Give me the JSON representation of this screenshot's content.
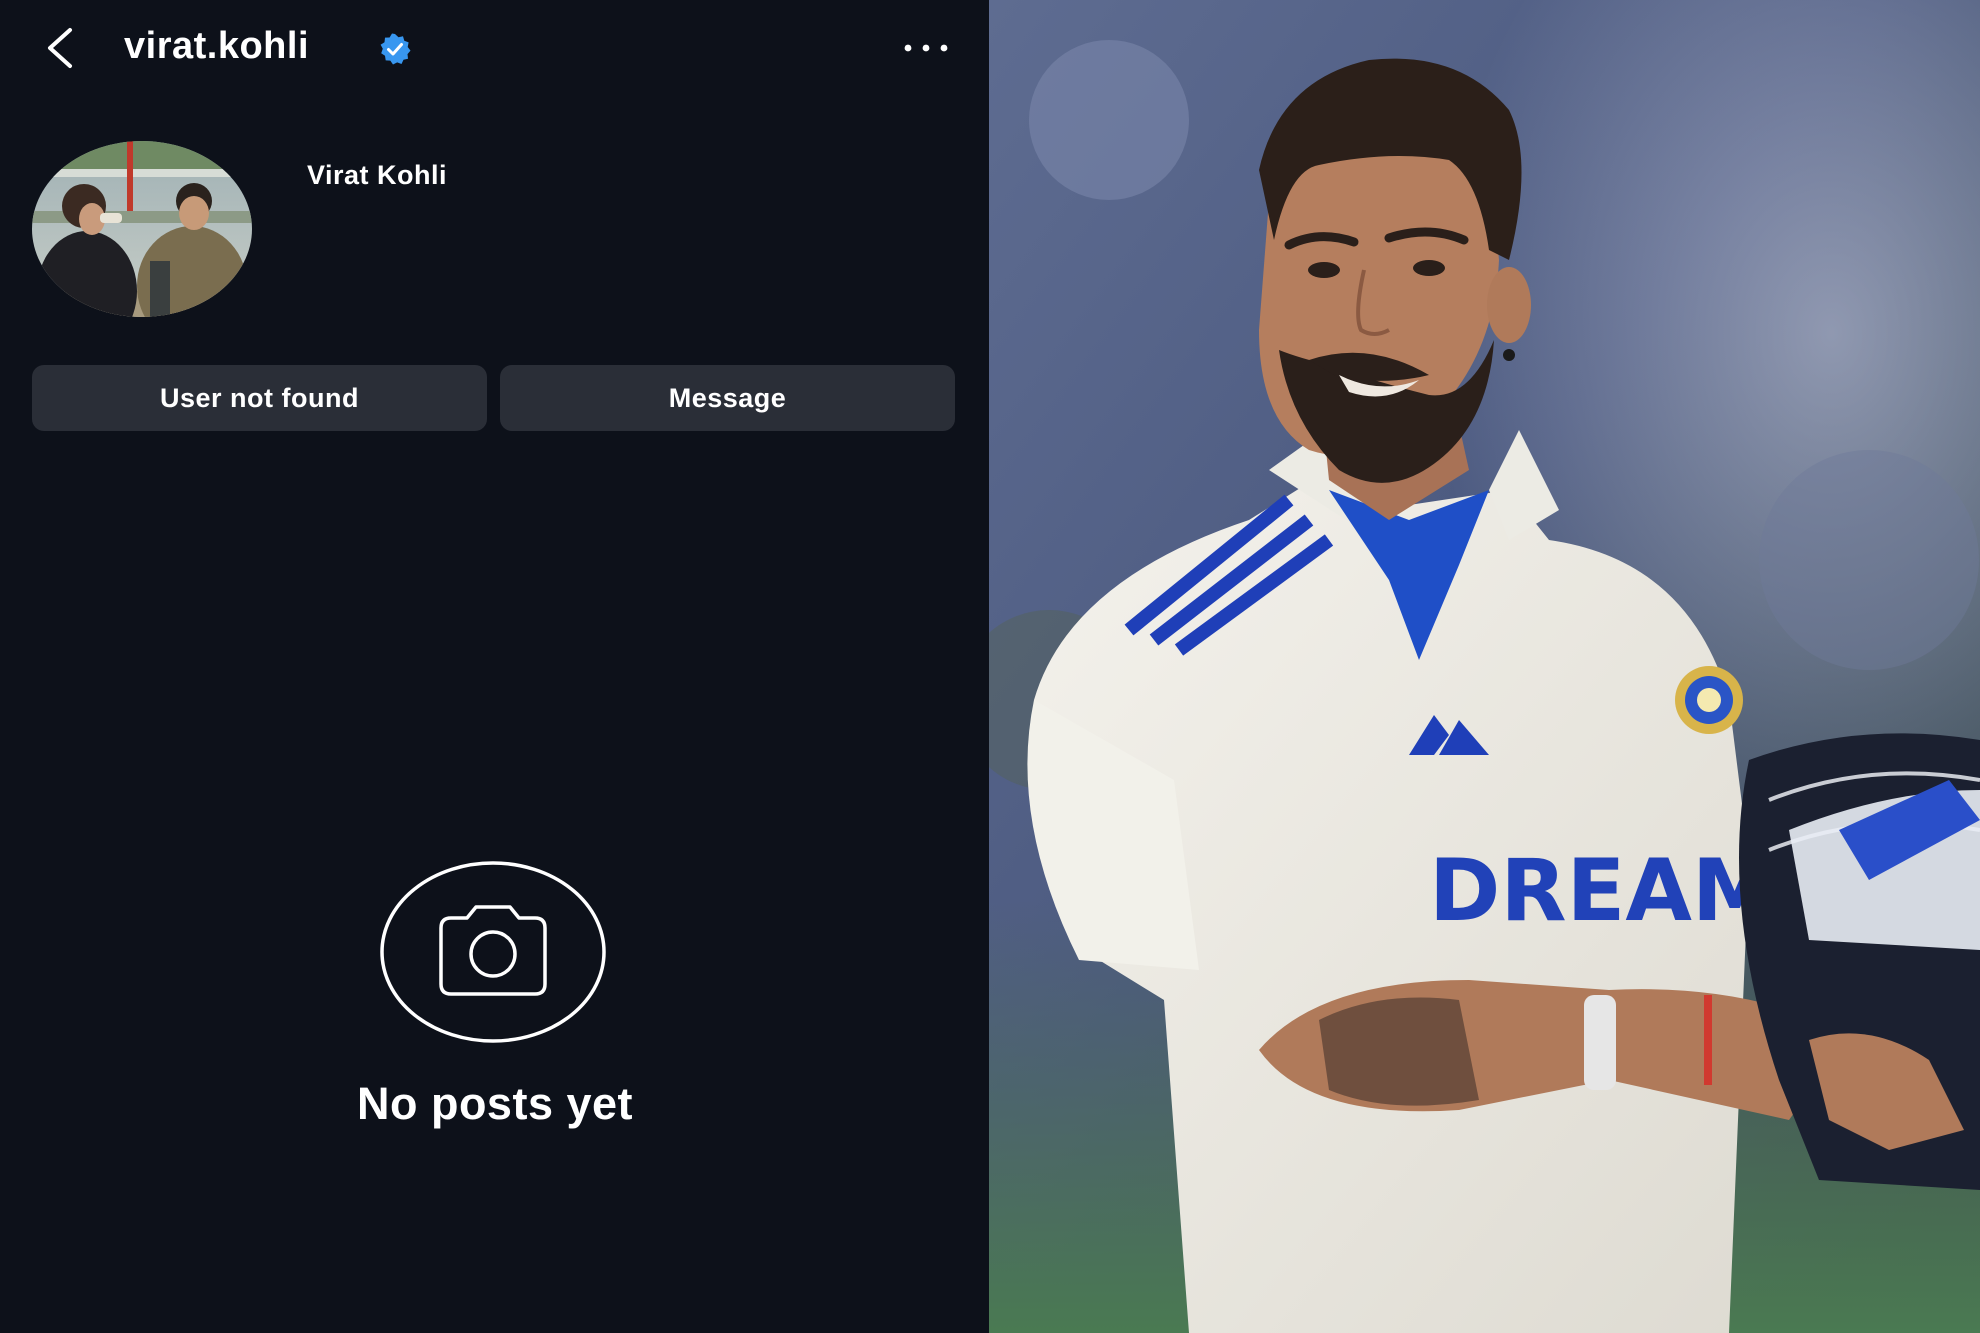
{
  "header": {
    "username": "virat.kohli",
    "verified": true,
    "back_icon": "chevron-left-icon",
    "more_icon": "more-horizontal-icon",
    "accent_color": "#3897f0"
  },
  "profile": {
    "display_name": "Virat Kohli"
  },
  "actions": {
    "status_label": "User not found",
    "message_label": "Message"
  },
  "posts": {
    "empty_icon": "camera-icon",
    "empty_label": "No posts yet"
  },
  "side_photo": {
    "jersey_text": "DREAM"
  },
  "colors": {
    "background": "#0d111a",
    "button": "#2a2e37",
    "text": "#ffffff"
  }
}
